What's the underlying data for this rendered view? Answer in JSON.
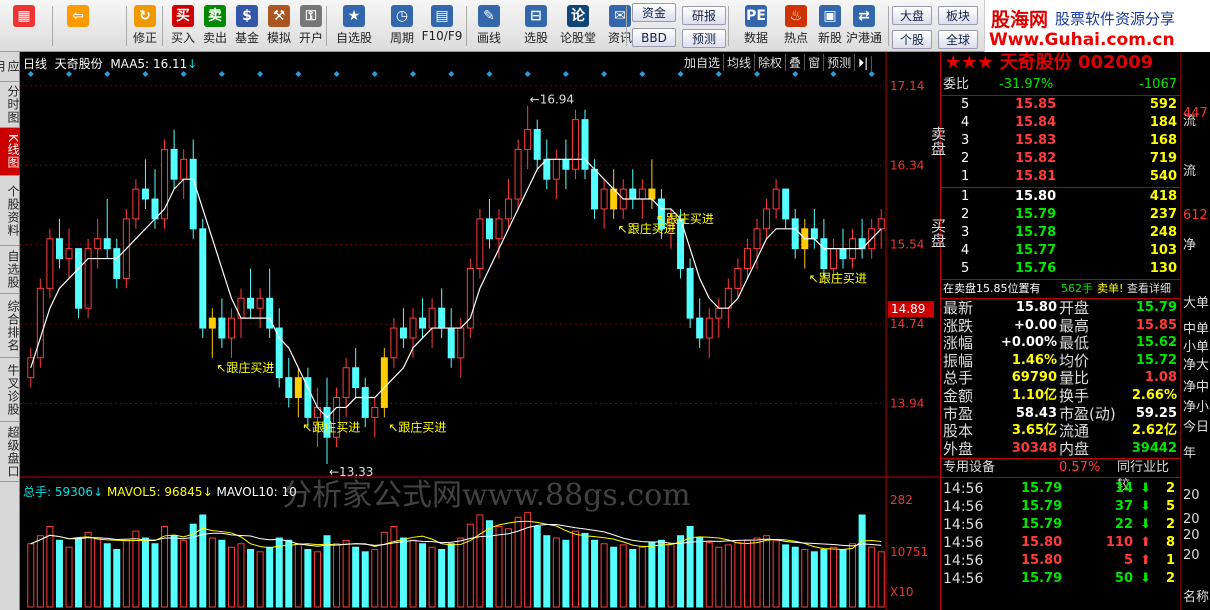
{
  "toolbar": {
    "buttons": [
      {
        "label": "",
        "icon": "grid-icon"
      },
      {
        "label": "",
        "icon": "back-arrow-icon"
      },
      {
        "label": "修正",
        "icon": "refresh-icon"
      },
      {
        "label": "买入",
        "icon": "buy-icon",
        "glyph": "买"
      },
      {
        "label": "卖出",
        "icon": "sell-icon",
        "glyph": "卖"
      },
      {
        "label": "基金",
        "icon": "fund-icon"
      },
      {
        "label": "模拟",
        "icon": "hammer-icon"
      },
      {
        "label": "开户",
        "icon": "lock-icon"
      },
      {
        "label": "自选股",
        "icon": "star-icon"
      },
      {
        "label": "周期",
        "icon": "clock-icon"
      },
      {
        "label": "F10/F9",
        "icon": "f10-icon"
      },
      {
        "label": "画线",
        "icon": "pen-icon"
      },
      {
        "label": "选股",
        "icon": "filter-icon"
      },
      {
        "label": "论股堂",
        "icon": "discuss-icon",
        "glyph": "论"
      },
      {
        "label": "资讯",
        "icon": "news-icon"
      },
      {
        "label": "数据",
        "icon": "pe-icon",
        "glyph": "PE"
      },
      {
        "label": "热点",
        "icon": "hot-icon"
      },
      {
        "label": "新股",
        "icon": "ipo-icon"
      },
      {
        "label": "沪港通",
        "icon": "hk-connect-icon"
      }
    ],
    "pills": {
      "fund": "资金",
      "bbd": "BBD",
      "research": "研报",
      "forecast": "预测",
      "market": "大盘",
      "sector": "板块",
      "personal": "个股",
      "global": "全球"
    },
    "logo": {
      "name": "股海网",
      "slogan": "股票软件资源分享",
      "url": "Www.Guhai.com.cn"
    }
  },
  "side_tabs": [
    {
      "label": "应用",
      "active": false
    },
    {
      "label": "分时图",
      "active": false
    },
    {
      "label": "K线图",
      "active": true
    },
    {
      "label": "个股资料",
      "active": false
    },
    {
      "label": "自选股",
      "active": false
    },
    {
      "label": "综合排名",
      "active": false
    },
    {
      "label": "牛叉诊股",
      "active": false
    },
    {
      "label": "超级盘口",
      "active": false
    }
  ],
  "chart_header": {
    "period": "日线",
    "stock": "天奇股份",
    "ma_label": "MAA5:",
    "ma_value": "16.11",
    "buttons": [
      "加自选",
      "均线",
      "除权",
      "叠",
      "窗",
      "预测"
    ]
  },
  "volume_header": {
    "total_label": "总手:",
    "total_value": "59306",
    "mavol5_label": "MAVOL5:",
    "mavol5_value": "96845",
    "mavol10_label": "MAVOL10:",
    "mavol10_value": "10"
  },
  "watermark": "分析家公式网www.88gs.com",
  "chart_data": {
    "type": "candlestick",
    "price_axis_labels": [
      "17.14",
      "16.34",
      "15.54",
      "14.74",
      "13.94"
    ],
    "price_ylim": [
      13.3,
      17.3
    ],
    "current_price_label": "14.89",
    "high_annotation": "16.94",
    "low_annotation": "13.33",
    "volume_axis_labels": [
      "282",
      "10751",
      "X10"
    ],
    "signal_label": "跟庄买进",
    "signal_indices": [
      19,
      28,
      37,
      61,
      65,
      81
    ],
    "candles": [
      [
        14.2,
        14.5,
        14.1,
        14.4
      ],
      [
        14.4,
        15.2,
        14.3,
        15.1
      ],
      [
        15.1,
        15.7,
        15.0,
        15.6
      ],
      [
        15.6,
        15.8,
        15.3,
        15.4
      ],
      [
        15.4,
        15.7,
        15.2,
        15.5
      ],
      [
        15.5,
        15.4,
        14.8,
        14.9
      ],
      [
        14.9,
        15.6,
        14.8,
        15.5
      ],
      [
        15.5,
        15.8,
        15.3,
        15.6
      ],
      [
        15.6,
        16.0,
        15.4,
        15.5
      ],
      [
        15.5,
        15.6,
        15.1,
        15.2
      ],
      [
        15.2,
        15.9,
        15.1,
        15.8
      ],
      [
        15.8,
        16.2,
        15.7,
        16.1
      ],
      [
        16.1,
        16.4,
        15.9,
        16.0
      ],
      [
        16.0,
        16.3,
        15.7,
        15.8
      ],
      [
        15.8,
        16.6,
        15.7,
        16.5
      ],
      [
        16.5,
        16.7,
        16.1,
        16.2
      ],
      [
        16.2,
        16.5,
        16.0,
        16.4
      ],
      [
        16.4,
        16.6,
        15.6,
        15.7
      ],
      [
        15.7,
        15.8,
        14.6,
        14.7
      ],
      [
        14.7,
        14.9,
        14.4,
        14.8
      ],
      [
        14.8,
        15.0,
        14.5,
        14.6
      ],
      [
        14.6,
        14.9,
        14.4,
        14.8
      ],
      [
        14.8,
        15.1,
        14.6,
        15.0
      ],
      [
        15.0,
        15.3,
        14.8,
        14.9
      ],
      [
        14.9,
        15.1,
        14.7,
        15.0
      ],
      [
        15.0,
        15.3,
        14.6,
        14.7
      ],
      [
        14.7,
        14.9,
        14.1,
        14.2
      ],
      [
        14.2,
        14.4,
        13.9,
        14.0
      ],
      [
        14.0,
        14.3,
        13.8,
        14.2
      ],
      [
        14.2,
        14.3,
        13.7,
        13.8
      ],
      [
        13.8,
        14.1,
        13.5,
        13.9
      ],
      [
        13.9,
        14.2,
        13.33,
        13.6
      ],
      [
        13.6,
        14.1,
        13.5,
        14.0
      ],
      [
        14.0,
        14.4,
        13.8,
        14.3
      ],
      [
        14.3,
        14.5,
        14.0,
        14.1
      ],
      [
        14.1,
        14.2,
        13.7,
        13.8
      ],
      [
        13.8,
        14.0,
        13.6,
        13.9
      ],
      [
        13.9,
        14.5,
        13.8,
        14.4
      ],
      [
        14.4,
        14.8,
        14.3,
        14.7
      ],
      [
        14.7,
        14.9,
        14.5,
        14.6
      ],
      [
        14.6,
        14.9,
        14.4,
        14.8
      ],
      [
        14.8,
        15.0,
        14.6,
        14.7
      ],
      [
        14.7,
        15.0,
        14.5,
        14.9
      ],
      [
        14.9,
        15.1,
        14.6,
        14.7
      ],
      [
        14.7,
        14.9,
        14.3,
        14.4
      ],
      [
        14.4,
        14.8,
        14.2,
        14.7
      ],
      [
        14.7,
        15.4,
        14.6,
        15.3
      ],
      [
        15.3,
        15.9,
        15.2,
        15.8
      ],
      [
        15.8,
        16.0,
        15.5,
        15.6
      ],
      [
        15.6,
        15.9,
        15.4,
        15.8
      ],
      [
        15.8,
        16.2,
        15.7,
        16.0
      ],
      [
        16.0,
        16.6,
        15.9,
        16.5
      ],
      [
        16.5,
        16.94,
        16.3,
        16.7
      ],
      [
        16.7,
        16.8,
        16.3,
        16.4
      ],
      [
        16.4,
        16.6,
        16.1,
        16.2
      ],
      [
        16.2,
        16.5,
        16.0,
        16.4
      ],
      [
        16.4,
        16.6,
        16.1,
        16.3
      ],
      [
        16.3,
        16.9,
        16.2,
        16.8
      ],
      [
        16.8,
        16.9,
        16.2,
        16.3
      ],
      [
        16.3,
        16.4,
        15.8,
        15.9
      ],
      [
        15.9,
        16.2,
        15.7,
        16.1
      ],
      [
        16.1,
        16.3,
        15.8,
        15.9
      ],
      [
        15.9,
        16.2,
        15.8,
        16.1
      ],
      [
        16.1,
        16.3,
        15.9,
        16.0
      ],
      [
        16.0,
        16.2,
        15.8,
        16.1
      ],
      [
        16.1,
        16.4,
        15.9,
        16.0
      ],
      [
        16.0,
        16.1,
        15.6,
        15.7
      ],
      [
        15.7,
        15.9,
        15.5,
        15.8
      ],
      [
        15.8,
        15.9,
        15.2,
        15.3
      ],
      [
        15.3,
        15.4,
        14.7,
        14.8
      ],
      [
        14.8,
        15.0,
        14.5,
        14.6
      ],
      [
        14.6,
        14.9,
        14.4,
        14.8
      ],
      [
        14.8,
        15.0,
        14.6,
        14.9
      ],
      [
        14.9,
        15.2,
        14.7,
        15.1
      ],
      [
        15.1,
        15.4,
        15.0,
        15.3
      ],
      [
        15.3,
        15.6,
        15.2,
        15.5
      ],
      [
        15.5,
        15.8,
        15.3,
        15.7
      ],
      [
        15.7,
        16.0,
        15.6,
        15.9
      ],
      [
        15.9,
        16.2,
        15.8,
        16.1
      ],
      [
        16.1,
        16.1,
        15.7,
        15.8
      ],
      [
        15.8,
        15.9,
        15.4,
        15.5
      ],
      [
        15.5,
        15.8,
        15.3,
        15.7
      ],
      [
        15.7,
        15.9,
        15.5,
        15.6
      ],
      [
        15.6,
        15.8,
        15.2,
        15.3
      ],
      [
        15.3,
        15.6,
        15.2,
        15.5
      ],
      [
        15.5,
        15.7,
        15.3,
        15.4
      ],
      [
        15.4,
        15.7,
        15.3,
        15.6
      ],
      [
        15.6,
        15.8,
        15.4,
        15.5
      ],
      [
        15.5,
        15.8,
        15.4,
        15.7
      ],
      [
        15.7,
        15.9,
        15.5,
        15.8
      ]
    ],
    "ma5": [
      14.3,
      14.6,
      14.9,
      15.1,
      15.2,
      15.3,
      15.4,
      15.4,
      15.4,
      15.4,
      15.5,
      15.6,
      15.7,
      15.8,
      15.9,
      16.1,
      16.2,
      16.2,
      15.9,
      15.6,
      15.3,
      15.0,
      14.8,
      14.8,
      14.8,
      14.8,
      14.6,
      14.5,
      14.3,
      14.1,
      13.9,
      13.8,
      13.9,
      13.9,
      14.0,
      14.0,
      14.0,
      14.1,
      14.2,
      14.3,
      14.5,
      14.6,
      14.7,
      14.7,
      14.7,
      14.7,
      14.8,
      15.1,
      15.3,
      15.5,
      15.7,
      15.9,
      16.1,
      16.3,
      16.4,
      16.4,
      16.4,
      16.4,
      16.4,
      16.3,
      16.2,
      16.1,
      16.0,
      16.0,
      16.0,
      16.0,
      15.9,
      15.9,
      15.8,
      15.5,
      15.2,
      15.0,
      14.9,
      14.9,
      15.0,
      15.2,
      15.4,
      15.6,
      15.7,
      15.7,
      15.7,
      15.6,
      15.6,
      15.5,
      15.5,
      15.5,
      15.5,
      15.5,
      15.6,
      15.7
    ],
    "volumes": [
      55,
      62,
      70,
      58,
      52,
      60,
      65,
      60,
      55,
      50,
      58,
      66,
      60,
      55,
      70,
      62,
      58,
      72,
      80,
      60,
      58,
      52,
      55,
      50,
      48,
      52,
      60,
      58,
      55,
      50,
      48,
      62,
      55,
      58,
      52,
      48,
      50,
      65,
      70,
      60,
      58,
      55,
      52,
      50,
      55,
      60,
      72,
      80,
      75,
      70,
      68,
      78,
      82,
      70,
      62,
      60,
      58,
      66,
      64,
      58,
      55,
      52,
      54,
      50,
      52,
      56,
      58,
      55,
      62,
      70,
      60,
      56,
      52,
      54,
      56,
      58,
      60,
      62,
      58,
      54,
      52,
      50,
      48,
      50,
      52,
      50,
      55,
      80,
      52,
      48
    ]
  },
  "quote": {
    "name": "天奇股份",
    "code": "002009",
    "weibi_label": "委比",
    "weibi_pct": "-31.97%",
    "weibi_diff": "-1067",
    "sell_label": "卖盘",
    "sell": [
      {
        "lvl": "5",
        "price": "15.85",
        "vol": "592"
      },
      {
        "lvl": "4",
        "price": "15.84",
        "vol": "184"
      },
      {
        "lvl": "3",
        "price": "15.83",
        "vol": "168"
      },
      {
        "lvl": "2",
        "price": "15.82",
        "vol": "719"
      },
      {
        "lvl": "1",
        "price": "15.81",
        "vol": "540"
      }
    ],
    "buy_label": "买盘",
    "buy": [
      {
        "lvl": "1",
        "price": "15.80",
        "vol": "418"
      },
      {
        "lvl": "2",
        "price": "15.79",
        "vol": "237"
      },
      {
        "lvl": "3",
        "price": "15.78",
        "vol": "248"
      },
      {
        "lvl": "4",
        "price": "15.77",
        "vol": "103"
      },
      {
        "lvl": "5",
        "price": "15.76",
        "vol": "130"
      }
    ],
    "note": "在卖盘15.85位置有",
    "note_vol": "562手",
    "note_tail": "卖单!",
    "note_link": "查看详细",
    "stats": [
      {
        "l1": "最新",
        "v1": "15.80",
        "l2": "开盘",
        "v2": "15.79",
        "c1": "wht",
        "c2": "grn"
      },
      {
        "l1": "涨跌",
        "v1": "+0.00",
        "l2": "最高",
        "v2": "15.85",
        "c1": "wht",
        "c2": "red"
      },
      {
        "l1": "涨幅",
        "v1": "+0.00%",
        "l2": "最低",
        "v2": "15.62",
        "c1": "wht",
        "c2": "grn"
      },
      {
        "l1": "振幅",
        "v1": "1.46%",
        "l2": "均价",
        "v2": "15.72",
        "c1": "yel",
        "c2": "grn"
      },
      {
        "l1": "总手",
        "v1": "69790",
        "l2": "量比",
        "v2": "1.08",
        "c1": "yel",
        "c2": "red"
      },
      {
        "l1": "金额",
        "v1": "1.10亿",
        "l2": "换手",
        "v2": "2.66%",
        "c1": "yel",
        "c2": "yel"
      },
      {
        "l1": "市盈",
        "v1": "58.43",
        "l2": "市盈(动)",
        "v2": "59.25",
        "c1": "wht",
        "c2": "wht"
      },
      {
        "l1": "股本",
        "v1": "3.65亿",
        "l2": "流通",
        "v2": "2.62亿",
        "c1": "yel",
        "c2": "yel"
      },
      {
        "l1": "外盘",
        "v1": "30348",
        "l2": "内盘",
        "v2": "39442",
        "c1": "red",
        "c2": "grn"
      }
    ],
    "device_label": "专用设备",
    "device_pct": "0.57%",
    "compare": "同行业比较",
    "ticks": [
      {
        "t": "14:56",
        "p": "15.79",
        "v": "14",
        "dir": "down",
        "n": "2",
        "c": "grn"
      },
      {
        "t": "14:56",
        "p": "15.79",
        "v": "37",
        "dir": "down",
        "n": "5",
        "c": "grn"
      },
      {
        "t": "14:56",
        "p": "15.79",
        "v": "22",
        "dir": "down",
        "n": "2",
        "c": "grn"
      },
      {
        "t": "14:56",
        "p": "15.80",
        "v": "110",
        "dir": "up",
        "n": "8",
        "c": "red"
      },
      {
        "t": "14:56",
        "p": "15.80",
        "v": "5",
        "dir": "up",
        "n": "1",
        "c": "red"
      },
      {
        "t": "14:56",
        "p": "15.79",
        "v": "50",
        "dir": "down",
        "n": "2",
        "c": "grn"
      }
    ]
  },
  "side_strip": [
    "流",
    "447",
    "流",
    "612",
    "净",
    "大单",
    "中单",
    "小单",
    "净大",
    "净中",
    "净小",
    "今日",
    "年",
    "20",
    "20",
    "20",
    "20",
    "名称"
  ]
}
